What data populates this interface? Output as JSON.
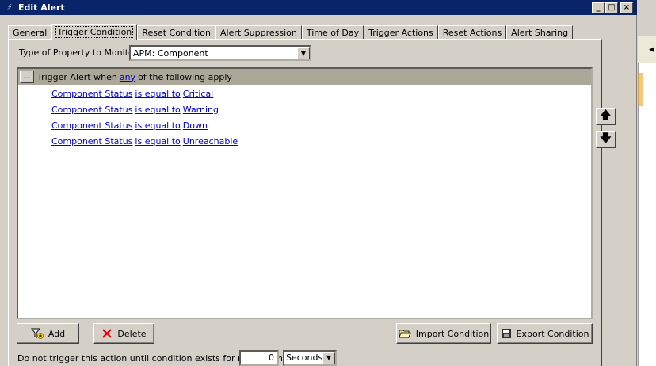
{
  "window": {
    "title": "Edit Alert"
  },
  "tabs": [
    {
      "label": "General",
      "active": false
    },
    {
      "label": "Trigger Condition",
      "active": true
    },
    {
      "label": "Reset Condition",
      "active": false
    },
    {
      "label": "Alert Suppression",
      "active": false
    },
    {
      "label": "Time of Day",
      "active": false
    },
    {
      "label": "Trigger Actions",
      "active": false
    },
    {
      "label": "Reset Actions",
      "active": false
    },
    {
      "label": "Alert Sharing",
      "active": false
    }
  ],
  "property": {
    "label": "Type of Property to Monitor:",
    "value": "APM: Component"
  },
  "condition_header": {
    "ellipsis": "...",
    "prefix": "Trigger Alert when",
    "quantifier": "any",
    "suffix": "of the following apply"
  },
  "conditions": [
    {
      "field": "Component Status",
      "operator": "is equal to",
      "value": "Critical"
    },
    {
      "field": "Component Status",
      "operator": "is equal to",
      "value": "Warning"
    },
    {
      "field": "Component Status",
      "operator": "is equal to",
      "value": "Down"
    },
    {
      "field": "Component Status",
      "operator": "is equal to",
      "value": "Unreachable"
    }
  ],
  "buttons": {
    "add": "Add",
    "delete": "Delete",
    "import": "Import Condition",
    "export": "Export Condition"
  },
  "delay": {
    "label": "Do not trigger this action until condition exists for more than",
    "value": "0",
    "unit": "Seconds"
  },
  "colors": {
    "titlebar": "#0a246a",
    "link": "#0000cc",
    "header_bar": "#aca899"
  }
}
